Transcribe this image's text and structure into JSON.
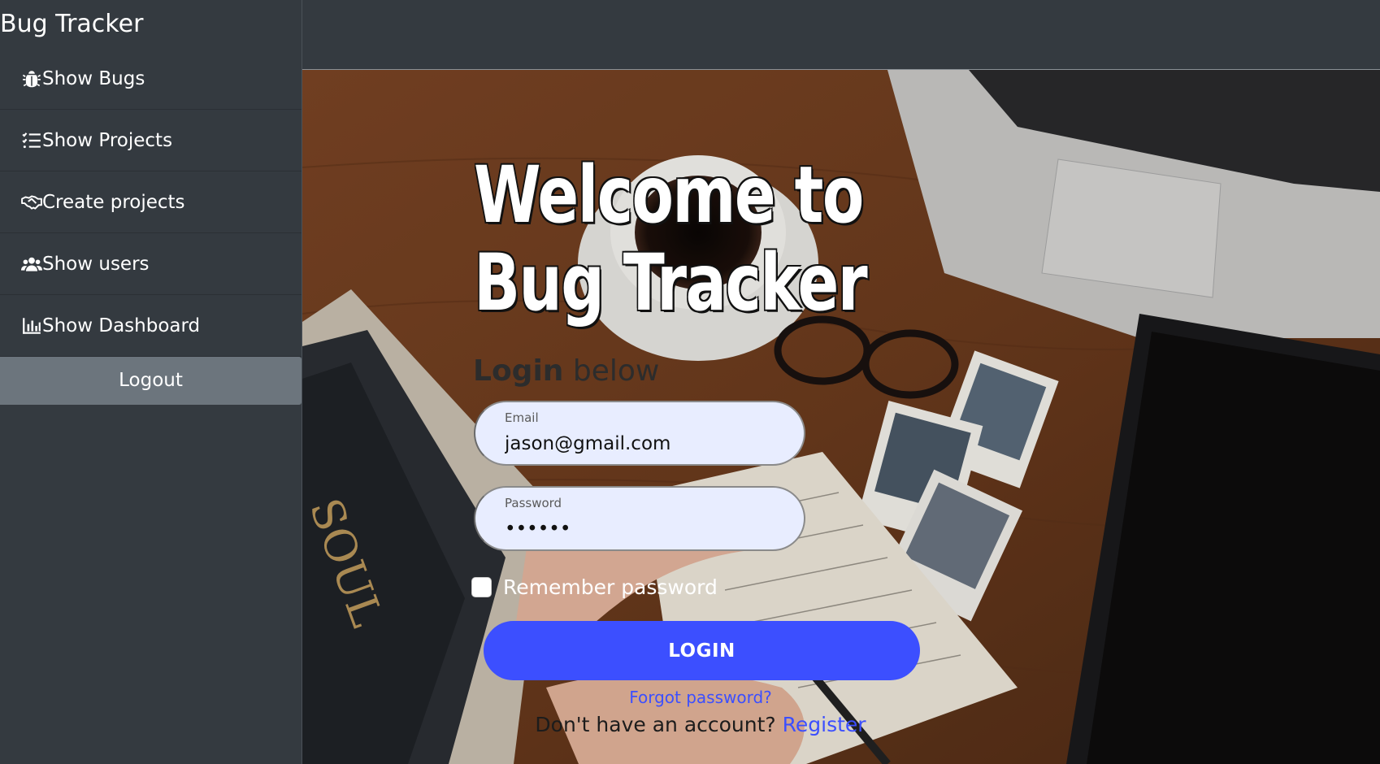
{
  "sidebar": {
    "brand": "Bug Tracker",
    "items": [
      {
        "label": "Show Bugs",
        "icon": "bug-icon"
      },
      {
        "label": "Show Projects",
        "icon": "tasks-list-icon"
      },
      {
        "label": "Create projects",
        "icon": "handshake-icon"
      },
      {
        "label": "Show users",
        "icon": "users-icon"
      },
      {
        "label": "Show Dashboard",
        "icon": "bar-chart-icon"
      }
    ],
    "logout_label": "Logout"
  },
  "hero": {
    "title": "Welcome to Bug Tracker"
  },
  "login_form": {
    "heading_bold": "Login",
    "heading_rest": " below",
    "email": {
      "label": "Email",
      "value": "jason@gmail.com"
    },
    "password": {
      "label": "Password",
      "value": "••••••"
    },
    "remember_label": "Remember password",
    "login_button": "LOGIN",
    "forgot_link": "Forgot password?",
    "no_account_text": "Don't have an account? ",
    "register_link": "Register"
  },
  "colors": {
    "sidebar_bg": "#343a40",
    "logout_bg": "#6c757d",
    "accent": "#3c4fff",
    "input_bg": "#e8edff"
  }
}
